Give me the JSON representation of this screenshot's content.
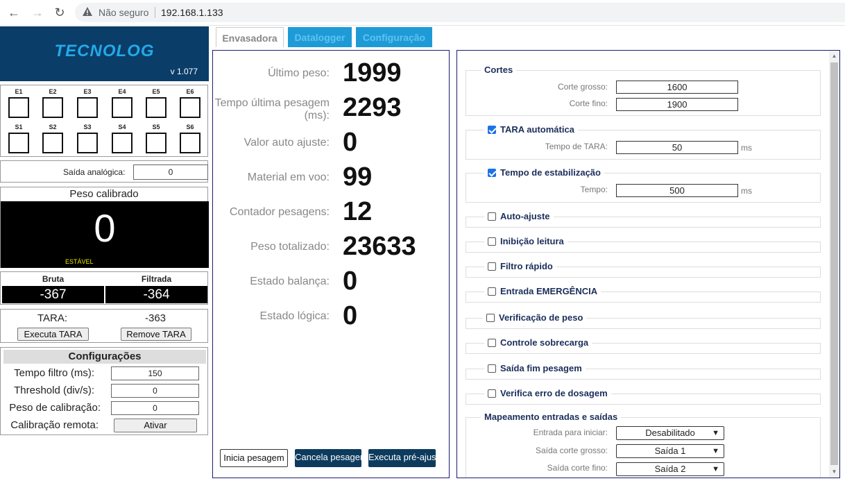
{
  "browser": {
    "security_label": "Não seguro",
    "url": "192.168.1.133"
  },
  "logo": {
    "brand": "TECNOLOG",
    "version": "v 1.077"
  },
  "io": {
    "inputs": [
      "E1",
      "E2",
      "E3",
      "E4",
      "E5",
      "E6"
    ],
    "outputs": [
      "S1",
      "S2",
      "S3",
      "S4",
      "S5",
      "S6"
    ]
  },
  "analog": {
    "label": "Saída analógica:",
    "value": "0"
  },
  "peso": {
    "title": "Peso calibrado",
    "value": "0",
    "status": "ESTÁVEL"
  },
  "raw": {
    "bruta_label": "Bruta",
    "bruta_value": "-367",
    "filtrada_label": "Filtrada",
    "filtrada_value": "-364"
  },
  "tara": {
    "label": "TARA:",
    "value": "-363",
    "exec_btn": "Executa TARA",
    "remove_btn": "Remove TARA"
  },
  "config": {
    "title": "Configurações",
    "rows": [
      {
        "label": "Tempo filtro (ms):",
        "value": "150"
      },
      {
        "label": "Threshold (div/s):",
        "value": "0"
      },
      {
        "label": "Peso de calibração:",
        "value": "0"
      },
      {
        "label": "Calibração remota:",
        "value": "Ativar"
      }
    ]
  },
  "tabs": [
    {
      "label": "Envasadora"
    },
    {
      "label": "Datalogger"
    },
    {
      "label": "Configuração"
    }
  ],
  "metrics": [
    {
      "label": "Último peso:",
      "value": "1999"
    },
    {
      "label": "Tempo última pesagem (ms):",
      "value": "2293"
    },
    {
      "label": "Valor auto ajuste:",
      "value": "0"
    },
    {
      "label": "Material em voo:",
      "value": "99"
    },
    {
      "label": "Contador pesagens:",
      "value": "12"
    },
    {
      "label": "Peso totalizado:",
      "value": "23633"
    },
    {
      "label": "Estado balança:",
      "value": "0"
    },
    {
      "label": "Estado lógica:",
      "value": "0"
    }
  ],
  "actions": {
    "inicia": "Inicia pesagem",
    "cancela": "Cancela pesagem",
    "pre": "Executa pré-ajuste"
  },
  "cortes": {
    "legend": "Cortes",
    "grosso_label": "Corte grosso:",
    "grosso_value": "1600",
    "fino_label": "Corte fino:",
    "fino_value": "1900"
  },
  "tara_auto": {
    "legend": "TARA automática",
    "label": "Tempo de TARA:",
    "value": "50",
    "unit": "ms"
  },
  "estab": {
    "legend": "Tempo de estabilização",
    "label": "Tempo:",
    "value": "500",
    "unit": "ms"
  },
  "options": [
    "Auto-ajuste",
    "Inibição leitura",
    "Filtro rápido",
    "Entrada EMERGÊNCIA",
    "Verificação de peso",
    "Controle sobrecarga",
    "Saída fim pesagem",
    "Verifica erro de dosagem"
  ],
  "mapping": {
    "legend": "Mapeamento entradas e saídas",
    "rows": [
      {
        "label": "Entrada para iniciar:",
        "value": "Desabilitado"
      },
      {
        "label": "Saída corte grosso:",
        "value": "Saída 1"
      },
      {
        "label": "Saída corte fino:",
        "value": "Saída 2"
      }
    ]
  },
  "colors": {
    "accent": "#1e9bd7",
    "navy": "#0a3d68",
    "dark_button": "#0d3b5e"
  }
}
